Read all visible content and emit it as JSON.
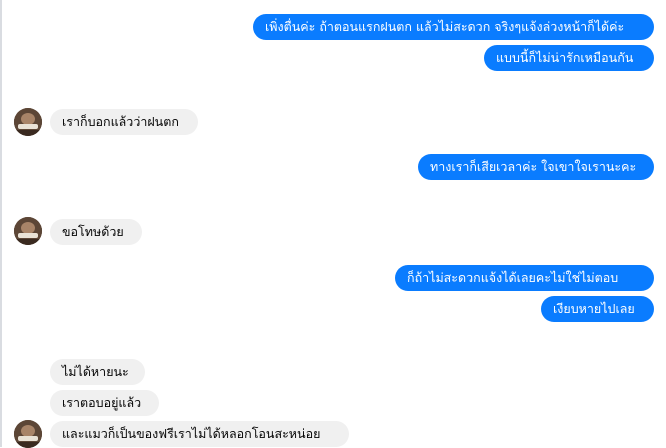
{
  "messages": {
    "out_1": "เพิ่งตื่นค่ะ ถ้าตอนแรกฝนตก แล้วไม่สะดวก จริงๆแจ้งล่วงหน้าก็ได้ค่ะ",
    "out_2": "แบบนี้ก็ไม่น่ารักเหมือนกัน",
    "in_1": "เราก็บอกแล้วว่าฝนตก",
    "out_3": "ทางเราก็เสียเวลาค่ะ ใจเขาใจเรานะคะ",
    "in_2": "ขอโทษด้วย",
    "out_4": "ก็ถ้าไม่สะดวกแจ้งได้เลยคะไม่ใช่ไม่ตอบ",
    "out_5": "เงียบหายไปเลย",
    "in_3": "ไม่ได้หายนะ",
    "in_4": "เราตอบอยู่แล้ว",
    "in_5": "และแมวก็เป็นของฟรีเราไม่ได้หลอกโอนสะหน่อย"
  },
  "colors": {
    "outgoing_bubble": "#0a7cff",
    "incoming_bubble": "#f0f0f0"
  },
  "icons": {
    "contact_avatar": "avatar-photo"
  }
}
